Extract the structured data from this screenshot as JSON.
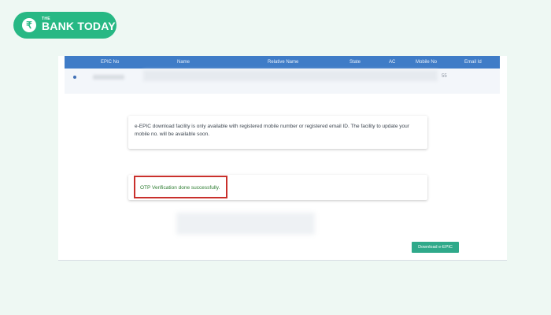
{
  "brand": {
    "icon_glyph": "₹",
    "small_text": "THE",
    "name": "BANK TODAY",
    "color": "#27b884"
  },
  "table": {
    "header_color": "#3f7cc7",
    "columns": [
      "EPIC No",
      "Name",
      "Relative Name",
      "State",
      "AC",
      "Mobile No",
      "Email Id"
    ],
    "row": {
      "tail_text": "55"
    }
  },
  "info_message": "e-EPIC download facility is only available with registered mobile number or registered email ID. The facility to update your mobile no. will be available soon.",
  "otp_message": "OTP Verification done successfully.",
  "otp_text_color": "#2e7d32",
  "highlight_color": "#c9302c",
  "download_button": {
    "label": "Download e-EPIC",
    "color": "#2fa98a"
  }
}
